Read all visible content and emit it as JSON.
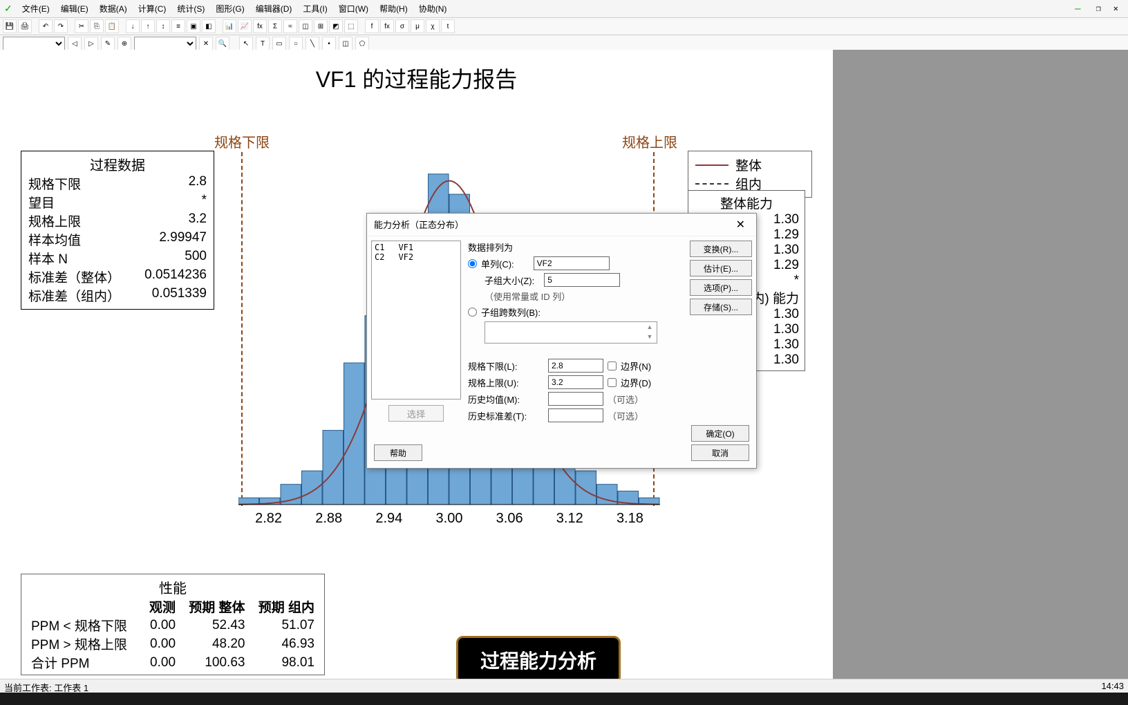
{
  "menus": [
    "文件(E)",
    "编辑(E)",
    "数据(A)",
    "计算(C)",
    "统计(S)",
    "图形(G)",
    "编辑器(D)",
    "工具(I)",
    "窗口(W)",
    "帮助(H)",
    "协助(N)"
  ],
  "window_controls": [
    "—",
    "❐",
    "✕"
  ],
  "report": {
    "title": "VF1 的过程能力报告",
    "lsl_label": "规格下限",
    "usl_label": "规格上限"
  },
  "process_data": {
    "header": "过程数据",
    "rows": [
      {
        "k": "规格下限",
        "v": "2.8"
      },
      {
        "k": "望目",
        "v": "*"
      },
      {
        "k": "规格上限",
        "v": "3.2"
      },
      {
        "k": "样本均值",
        "v": "2.99947"
      },
      {
        "k": "样本 N",
        "v": "500"
      },
      {
        "k": "标准差（整体）",
        "v": "0.0514236"
      },
      {
        "k": "标准差（组内）",
        "v": "0.051339"
      }
    ]
  },
  "legend": {
    "overall": "整体",
    "within": "组内"
  },
  "capability": {
    "overall_header": "整体能力",
    "within_header": "(组内) 能力",
    "values": [
      "1.30",
      "1.29",
      "1.30",
      "1.29",
      "*",
      "1.30",
      "1.30",
      "1.30",
      "1.30"
    ]
  },
  "performance": {
    "header": "性能",
    "cols": [
      "",
      "观测",
      "预期 整体",
      "预期 组内"
    ],
    "rows": [
      {
        "k": "PPM < 规格下限",
        "v": [
          "0.00",
          "52.43",
          "51.07"
        ]
      },
      {
        "k": "PPM > 规格上限",
        "v": [
          "0.00",
          "48.20",
          "46.93"
        ]
      },
      {
        "k": "合计 PPM",
        "v": [
          "0.00",
          "100.63",
          "98.01"
        ]
      }
    ]
  },
  "subtitle": "过程能力分析",
  "status": {
    "left": "当前工作表: 工作表 1",
    "right": "14:43"
  },
  "dialog": {
    "title": "能力分析（正态分布）",
    "columns": [
      {
        "c": "C1",
        "n": "VF1"
      },
      {
        "c": "C2",
        "n": "VF2"
      }
    ],
    "arrange_label": "数据排列为",
    "single_col": "单列(C):",
    "single_col_val": "VF2",
    "subgroup_size": "子组大小(Z):",
    "subgroup_size_val": "5",
    "use_const": "（使用常量或 ID 列）",
    "across_cols": "子组跨数列(B):",
    "lsl": "规格下限(L):",
    "lsl_val": "2.8",
    "bound_n": "边界(N)",
    "usl": "规格上限(U):",
    "usl_val": "3.2",
    "bound_d": "边界(D)",
    "hist_mean": "历史均值(M):",
    "optional": "（可选）",
    "hist_sd": "历史标准差(T):",
    "btn_transform": "变换(R)...",
    "btn_estimate": "估计(E)...",
    "btn_options": "选项(P)...",
    "btn_store": "存储(S)...",
    "btn_select": "选择",
    "btn_help": "帮助",
    "btn_ok": "确定(O)",
    "btn_cancel": "取消"
  },
  "chart_data": {
    "type": "bar",
    "categories": [
      "2.82",
      "2.88",
      "2.94",
      "3.00",
      "3.06",
      "3.12",
      "3.18"
    ],
    "xlabel": "",
    "ylabel": "",
    "title": "",
    "bins_x": [
      2.81,
      2.83,
      2.85,
      2.87,
      2.89,
      2.91,
      2.93,
      2.95,
      2.97,
      2.99,
      3.01,
      3.03,
      3.05,
      3.07,
      3.09,
      3.11,
      3.13,
      3.15,
      3.17,
      3.19
    ],
    "values": [
      2,
      2,
      6,
      10,
      22,
      42,
      56,
      74,
      86,
      98,
      92,
      78,
      62,
      46,
      30,
      16,
      10,
      6,
      4,
      2
    ],
    "ylim": [
      0,
      100
    ],
    "lsl": 2.8,
    "usl": 3.2,
    "curves": [
      "overall",
      "within"
    ]
  }
}
